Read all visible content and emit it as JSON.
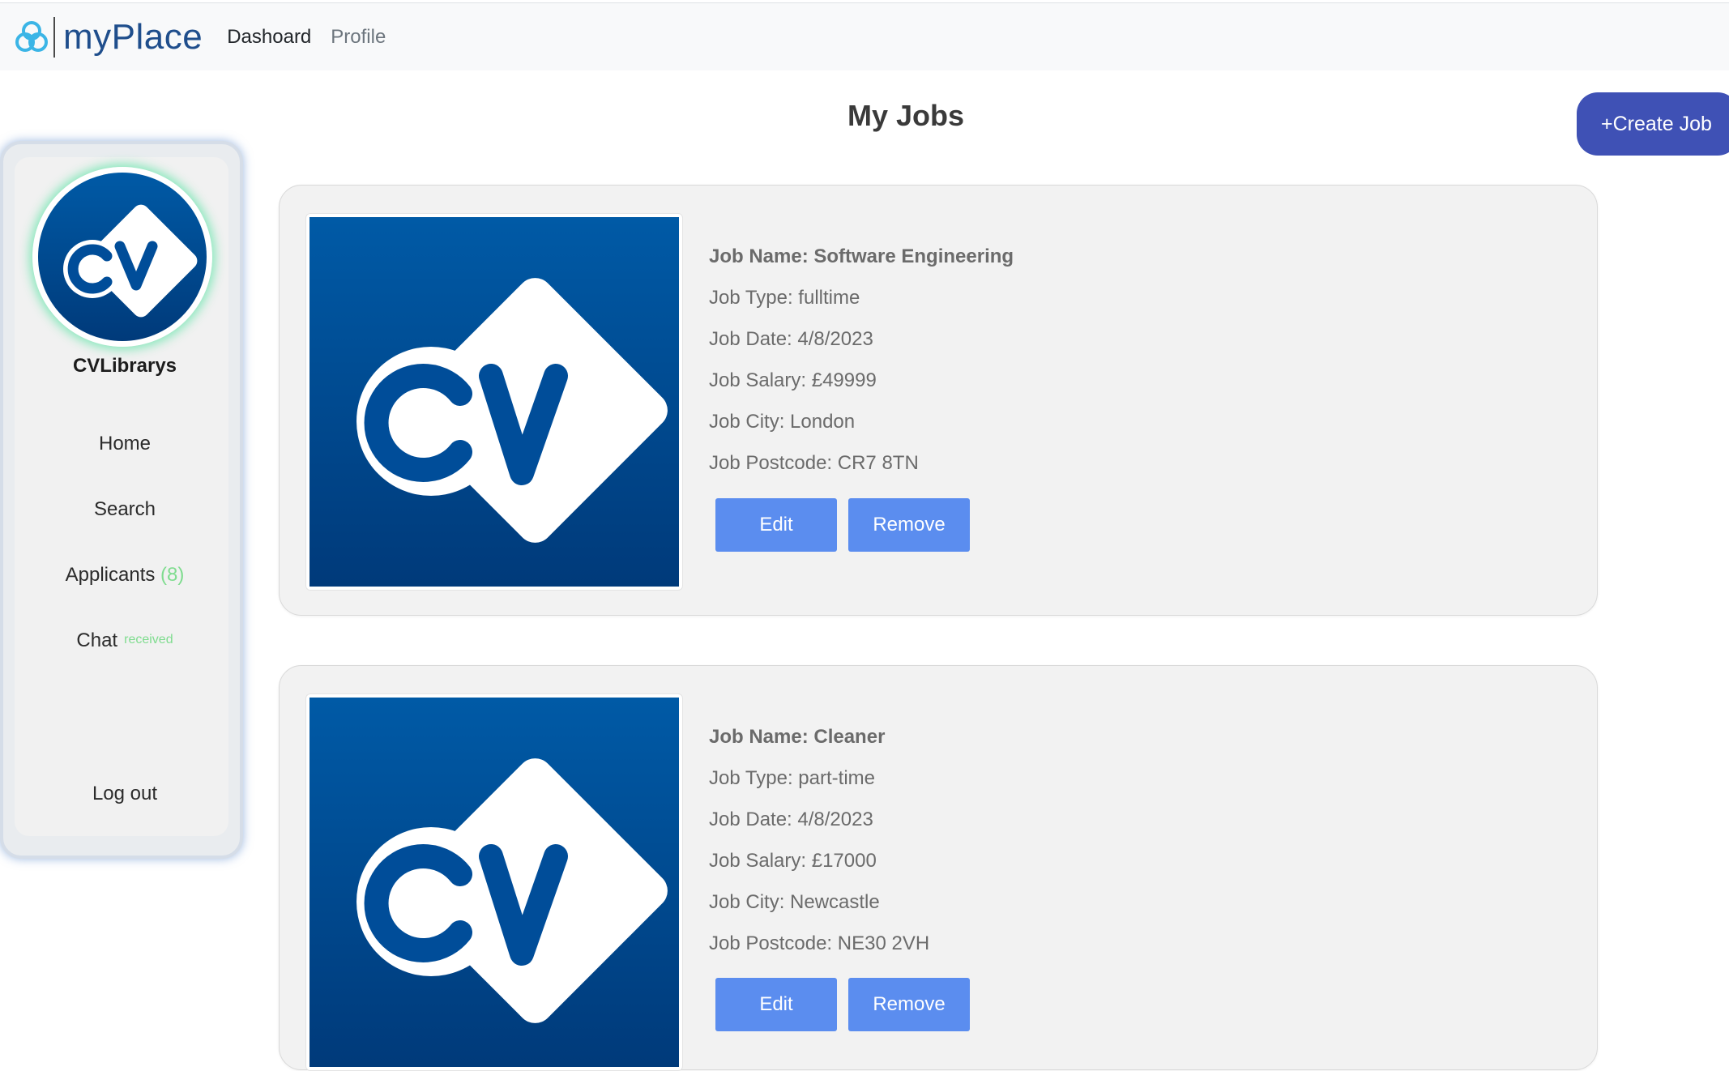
{
  "navbar": {
    "brand_name": "myPlace",
    "links": [
      "Dashoard",
      "Profile"
    ]
  },
  "page": {
    "title": "My Jobs",
    "create_button": "+Create Job"
  },
  "sidebar": {
    "company_name": "CVLibrarys",
    "items": {
      "home": "Home",
      "search": "Search",
      "applicants": "Applicants",
      "applicants_count": "(8)",
      "chat": "Chat",
      "chat_status": "received",
      "logout": "Log out"
    }
  },
  "jobs": [
    {
      "name": "Job Name: Software Engineering",
      "type": "Job Type: fulltime",
      "date": "Job Date: 4/8/2023",
      "salary": "Job Salary: £49999",
      "city": "Job City: London",
      "postcode": "Job Postcode: CR7 8TN",
      "edit_label": "Edit",
      "remove_label": "Remove"
    },
    {
      "name": "Job Name: Cleaner",
      "type": "Job Type: part-time",
      "date": "Job Date: 4/8/2023",
      "salary": "Job Salary: £17000",
      "city": "Job City: Newcastle",
      "postcode": "Job Postcode: NE30 2VH",
      "edit_label": "Edit",
      "remove_label": "Remove"
    }
  ],
  "colors": {
    "brand_blue": "#1f4e8c",
    "create_button": "#3f51b5",
    "action_button": "#5b8def",
    "badge_green": "#7fdc8f",
    "cv_logo_top": "#005aa6",
    "cv_logo_bottom": "#003a7a"
  },
  "icons": {
    "brand": "myplace-logo-icon",
    "company_avatar": "cv-library-logo-icon",
    "job_image": "cv-library-logo-icon"
  }
}
